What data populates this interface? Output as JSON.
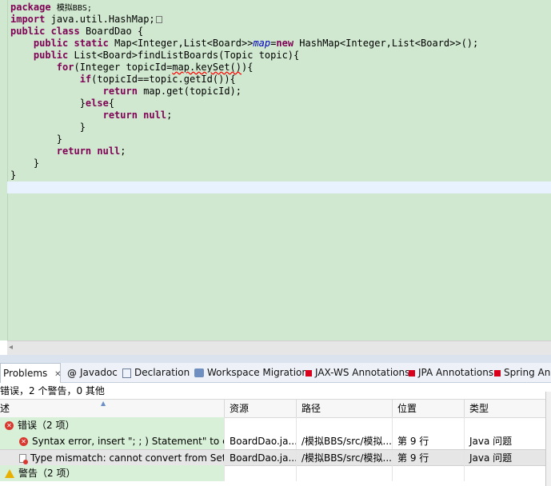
{
  "editor": {
    "code_lines": [
      "package 模拟BBS;",
      "import java.util.HashMap;",
      "public class BoardDao {",
      "    public static Map<Integer,List<Board>>map=new HashMap<Integer,List<Board>>();",
      "    public List<Board>findListBoards(Topic topic){",
      "        for(Integer topicId=map.keySet()){",
      "            if(topicId==topic.getId()){",
      "                return map.get(topicId);",
      "            }else{",
      "                return null;",
      "            }",
      "        }",
      "        return null;",
      "    }",
      "}"
    ]
  },
  "views": {
    "tabs": [
      {
        "label": "Problems",
        "close": "✕",
        "icon": "problems-icon"
      },
      {
        "label": "Javadoc",
        "icon": "javadoc-icon",
        "glyph": "@"
      },
      {
        "label": "Declaration",
        "icon": "declaration-icon"
      },
      {
        "label": "Workspace Migration",
        "icon": "workspace-migration-icon"
      },
      {
        "label": "JAX-WS Annotations",
        "icon": "jaxws-annotations-icon"
      },
      {
        "label": "JPA Annotations",
        "icon": "jpa-annotations-icon"
      },
      {
        "label": "Spring Ann",
        "icon": "spring-annotations-icon"
      }
    ]
  },
  "problems": {
    "summary": "错误，2 个警告，0 其他",
    "columns": [
      "述",
      "资源",
      "路径",
      "位置",
      "类型"
    ],
    "groups": {
      "errors": {
        "label": "错误（2 项）"
      },
      "warnings": {
        "label": "警告（2 项）"
      }
    },
    "rows": [
      {
        "description": "Syntax error, insert \"; ; ) Statement\" to co",
        "resource": "BoardDao.ja...",
        "path": "/模拟BBS/src/模拟...",
        "location": "第 9 行",
        "type": "Java 问题"
      },
      {
        "description": "Type mismatch: cannot convert from Set<",
        "resource": "BoardDao.ja...",
        "path": "/模拟BBS/src/模拟...",
        "location": "第 9 行",
        "type": "Java 问题"
      }
    ]
  },
  "colors": {
    "editor_bg": "#cfe8cf",
    "keyword": "#7f0055",
    "field": "#0000c0",
    "error": "#d7382f",
    "warning": "#e8b000"
  }
}
